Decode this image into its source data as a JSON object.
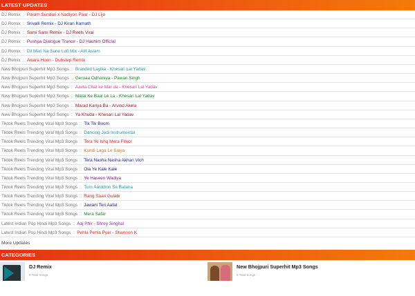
{
  "header": {
    "latest_title": "LATEST UPDATES",
    "categories_title": "CATEGORIES"
  },
  "separator": " :: ",
  "updates": [
    {
      "category": "DJ Remix",
      "title": "Param Sundari x Nadiyon Paar - DJ Lijo",
      "color": "red"
    },
    {
      "category": "DJ Remix",
      "title": "Srivalli Remix - DJ Kiran Kamath",
      "color": "blue"
    },
    {
      "category": "DJ Remix",
      "title": "Sami Sami Remix - DJ Reels Viral",
      "color": "maroon"
    },
    {
      "category": "DJ Remix",
      "title": "Pushpa Dialogue Trance - DJ Hashim Official",
      "color": "purple"
    },
    {
      "category": "DJ Remix",
      "title": "Dil Meri Na Sune Lofi Mix - Atif Aslam",
      "color": "teal"
    },
    {
      "category": "DJ Remix",
      "title": "Awara Hoon - Dubstep Remix",
      "color": "red"
    },
    {
      "category": "New Bhojpuri Superhit Mp3 Songs",
      "title": "Branded Layika - Khesari Lal Yadav",
      "color": "teal"
    },
    {
      "category": "New Bhojpuri Superhit Mp3 Songs",
      "title": "Geruaa Odhaniya - Pawan Singh",
      "color": "green"
    },
    {
      "category": "New Bhojpuri Superhit Mp3 Songs",
      "title": "Aavta Chat ke Mar da - Khesari Lal Yadav",
      "color": "pink"
    },
    {
      "category": "New Bhojpuri Superhit Mp3 Songs",
      "title": "Matai Ke Baal Le La - Khesari Lal Yadav",
      "color": "green"
    },
    {
      "category": "New Bhojpuri Superhit Mp3 Songs",
      "title": "Marad Kariya Ba - Arvind Akela",
      "color": "maroon"
    },
    {
      "category": "New Bhojpuri Superhit Mp3 Songs",
      "title": "Ya Khuda - Khesari Lal Yadav",
      "color": "maroon"
    },
    {
      "category": "Tiktok Reels Trending Viral Mp3 Songs",
      "title": "Tik Tik Boom",
      "color": "navy"
    },
    {
      "category": "Tiktok Reels Trending Viral Mp3 Songs",
      "title": "Dancing Jodi Instrumental",
      "color": "teal"
    },
    {
      "category": "Tiktok Reels Trending Viral Mp3 Songs",
      "title": "Tera Ye Ishq Mera Fitoor",
      "color": "red"
    },
    {
      "category": "Tiktok Reels Trending Viral Mp3 Songs",
      "title": "Kundi Laga Le Saiya",
      "color": "orange"
    },
    {
      "category": "Tiktok Reels Trending Viral Mp3 Songs",
      "title": "Tera Nasha Nasha Akhan Vich",
      "color": "blue"
    },
    {
      "category": "Tiktok Reels Trending Viral Mp3 Songs",
      "title": "Ola Ye Kale Kale",
      "color": "navy"
    },
    {
      "category": "Tiktok Reels Trending Viral Mp3 Songs",
      "title": "Ye Haseen Wadiya",
      "color": "purple"
    },
    {
      "category": "Tiktok Reels Trending Viral Mp3 Songs",
      "title": "Tum Aankhon Se Batana",
      "color": "teal"
    },
    {
      "category": "Tiktok Reels Trending Viral Mp3 Songs",
      "title": "Rang Saari Gulabi",
      "color": "red"
    },
    {
      "category": "Tiktok Reels Trending Viral Mp3 Songs",
      "title": "Jawani Teri Aafat",
      "color": "navy"
    },
    {
      "category": "Tiktok Reels Trending Viral Mp3 Songs",
      "title": "Mera Safar",
      "color": "green"
    },
    {
      "category": "Latest Indian Pop Hindi Mp3 Songs",
      "title": "Aaj Phir - Shrey Singhal",
      "color": "violet"
    },
    {
      "category": "Latest Indian Pop Hindi Mp3 Songs",
      "title": "Pehla Pehla Pyar - Shannon K",
      "color": "red"
    }
  ],
  "more_updates": "More Updates",
  "categories": [
    {
      "name": "DJ Remix",
      "sub": "6 Total Songs"
    },
    {
      "name": "New Bhojpuri Superhit Mp3 Songs",
      "sub": "6 Total Songs"
    }
  ]
}
